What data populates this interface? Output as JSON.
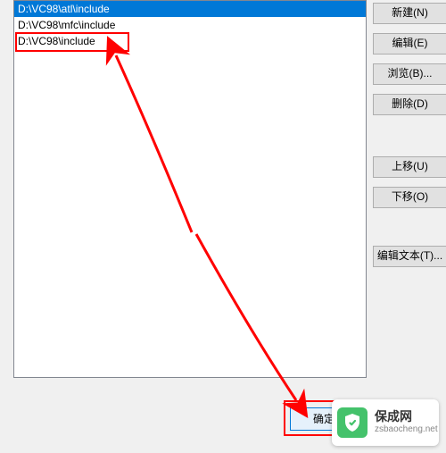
{
  "list": {
    "items": [
      {
        "path": "D:\\VC98\\atl\\include",
        "selected": true
      },
      {
        "path": "D:\\VC98\\mfc\\include",
        "selected": false
      },
      {
        "path": "D:\\VC98\\include",
        "selected": false
      }
    ]
  },
  "buttons": {
    "new": "新建(N)",
    "edit": "编辑(E)",
    "browse": "浏览(B)...",
    "delete": "删除(D)",
    "moveup": "上移(U)",
    "movedn": "下移(O)",
    "edittxt": "编辑文本(T)...",
    "ok": "确定"
  },
  "annotations": {
    "highlight_item_index": 2,
    "highlight_ok": true
  },
  "watermark": {
    "title": "保成网",
    "url": "zsbaocheng.net"
  }
}
